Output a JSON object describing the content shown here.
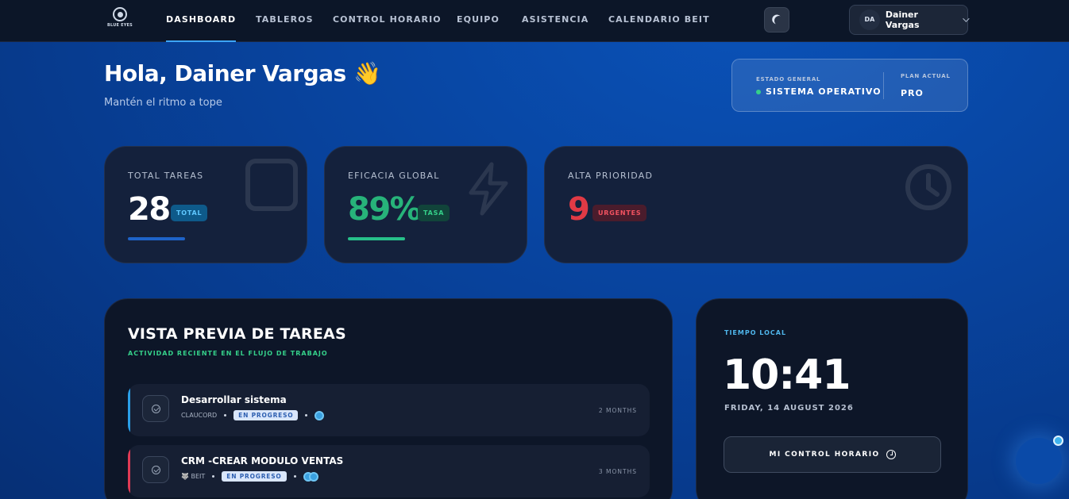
{
  "nav": {
    "brand": "BLUE EYES",
    "tabs": [
      {
        "label": "DASHBOARD",
        "active": true
      },
      {
        "label": "TABLEROS",
        "active": false
      },
      {
        "label": "CONTROL HORARIO",
        "active": false
      },
      {
        "label": "EQUIPO",
        "active": false
      },
      {
        "label": "ASISTENCIA",
        "active": false
      },
      {
        "label": "CALENDARIO BEIT",
        "active": false
      }
    ],
    "user": {
      "initials": "DA",
      "name": "Dainer Vargas"
    }
  },
  "greeting": {
    "title": "Hola, Dainer Vargas 👋",
    "subtitle": "Mantén el ritmo a tope"
  },
  "status": {
    "estado_label": "ESTADO GENERAL",
    "estado_value": "SISTEMA OPERATIVO",
    "plan_label": "PLAN ACTUAL",
    "plan_value": "PRO"
  },
  "stats": [
    {
      "label": "TOTAL TAREAS",
      "value": "28",
      "badge": "TOTAL",
      "color": "#ffffff",
      "badge_bg": "#0e5a8a",
      "badge_fg": "#5fc8ff",
      "bar": "#1e63c8"
    },
    {
      "label": "EFICACIA GLOBAL",
      "value": "89%",
      "badge": "TASA",
      "color": "#27b37a",
      "badge_bg": "#11443a",
      "badge_fg": "#35d08a",
      "bar": "#27c08a"
    },
    {
      "label": "ALTA PRIORIDAD",
      "value": "9",
      "badge": "URGENTES",
      "color": "#e03a45",
      "badge_bg": "#4a1c2c",
      "badge_fg": "#f25361",
      "bar": ""
    }
  ],
  "tasks": {
    "title": "VISTA PREVIA DE TAREAS",
    "subtitle": "ACTIVIDAD RECIENTE EN EL FLUJO DE TRABAJO",
    "items": [
      {
        "name": "Desarrollar sistema",
        "project": "CLAUCORD",
        "state": "EN PROGRESO",
        "time": "2 MONTHS",
        "accent": "#2a9fe8"
      },
      {
        "name": "CRM -CREAR MODULO VENTAS",
        "project": "🐺 BEIT",
        "state": "EN PROGRESO",
        "time": "3 MONTHS",
        "accent": "#e03a55"
      }
    ]
  },
  "clock": {
    "label": "TIEMPO LOCAL",
    "time": "10:41",
    "date": "FRIDAY, 14 AUGUST 2026",
    "button": "MI CONTROL HORARIO"
  }
}
